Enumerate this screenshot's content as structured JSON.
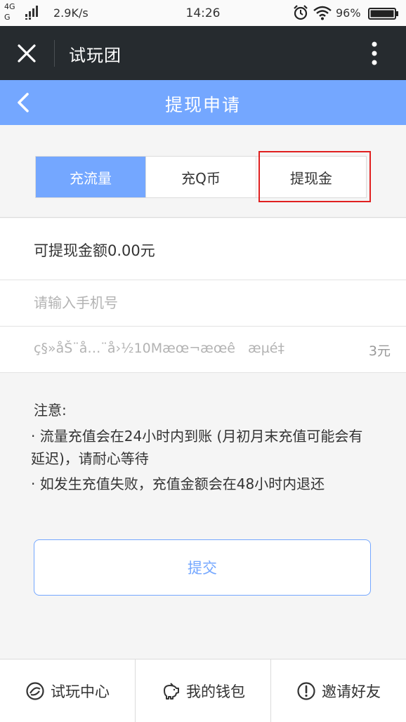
{
  "status_bar": {
    "network_top": "4G",
    "network_bottom": "G",
    "speed": "2.9K/s",
    "time": "14:26",
    "battery_percent": "96%"
  },
  "title_bar": {
    "title": "试玩团"
  },
  "header": {
    "title": "提现申请"
  },
  "tabs": [
    {
      "label": "充流量",
      "active": true
    },
    {
      "label": "充Q币",
      "active": false
    },
    {
      "label": "提现金",
      "active": false
    }
  ],
  "form": {
    "available_amount": "可提现金额0.00元",
    "phone_placeholder": "请输入手机号",
    "package_text": "ç§»åŠ¨å…¨å›½10Mæœ¬æœê   æµé‡",
    "package_price": "3元"
  },
  "notice": {
    "title": "注意:",
    "line1": "· 流量充值会在24小时内到账 (月初月末充值可能会有延迟)，请耐心等待",
    "line2": "· 如发生充值失败，充值金额会在48小时内退还"
  },
  "submit_label": "提交",
  "bottom_nav": [
    {
      "label": "试玩中心",
      "icon": "trial-center-icon"
    },
    {
      "label": "我的钱包",
      "icon": "wallet-piggy-icon"
    },
    {
      "label": "邀请好友",
      "icon": "invite-exclamation-icon"
    }
  ],
  "colors": {
    "accent": "#74a7ff",
    "title_bar": "#262b2f",
    "highlight": "#e02020"
  }
}
